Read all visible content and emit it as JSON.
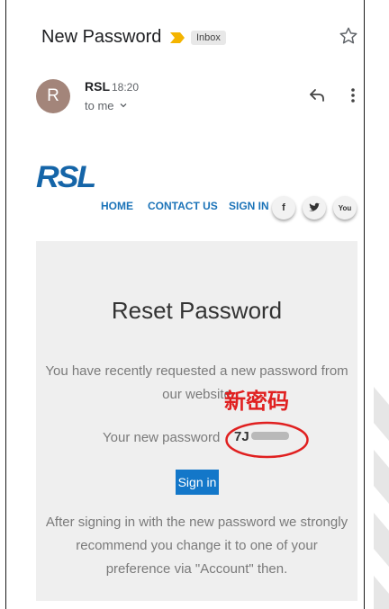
{
  "email": {
    "subject": "New Password",
    "label": "Inbox",
    "sender_name": "RSL",
    "sender_initial": "R",
    "time": "18:20",
    "recipient": "to me"
  },
  "brand": {
    "logo_text": "RSL",
    "nav": [
      "HOME",
      "CONTACT US",
      "SIGN IN"
    ],
    "social": [
      "f",
      "t",
      "You"
    ]
  },
  "card": {
    "title": "Reset Password",
    "requested_line1": "You have recently requested a new password from",
    "requested_line2": "our website",
    "password_label": "Your new password",
    "password_value": "7J",
    "signin_label": "Sign in",
    "after_line1": "After signing in with the new password we strongly",
    "after_line2": "recommend you change it to one of your",
    "after_line3": "preference via \"Account\" then."
  },
  "annotation": {
    "text": "新密码"
  },
  "colors": {
    "brand_blue": "#1565a8",
    "button_blue": "#1377c9",
    "annotation_red": "#e02020",
    "important_yellow": "#f4b400"
  }
}
